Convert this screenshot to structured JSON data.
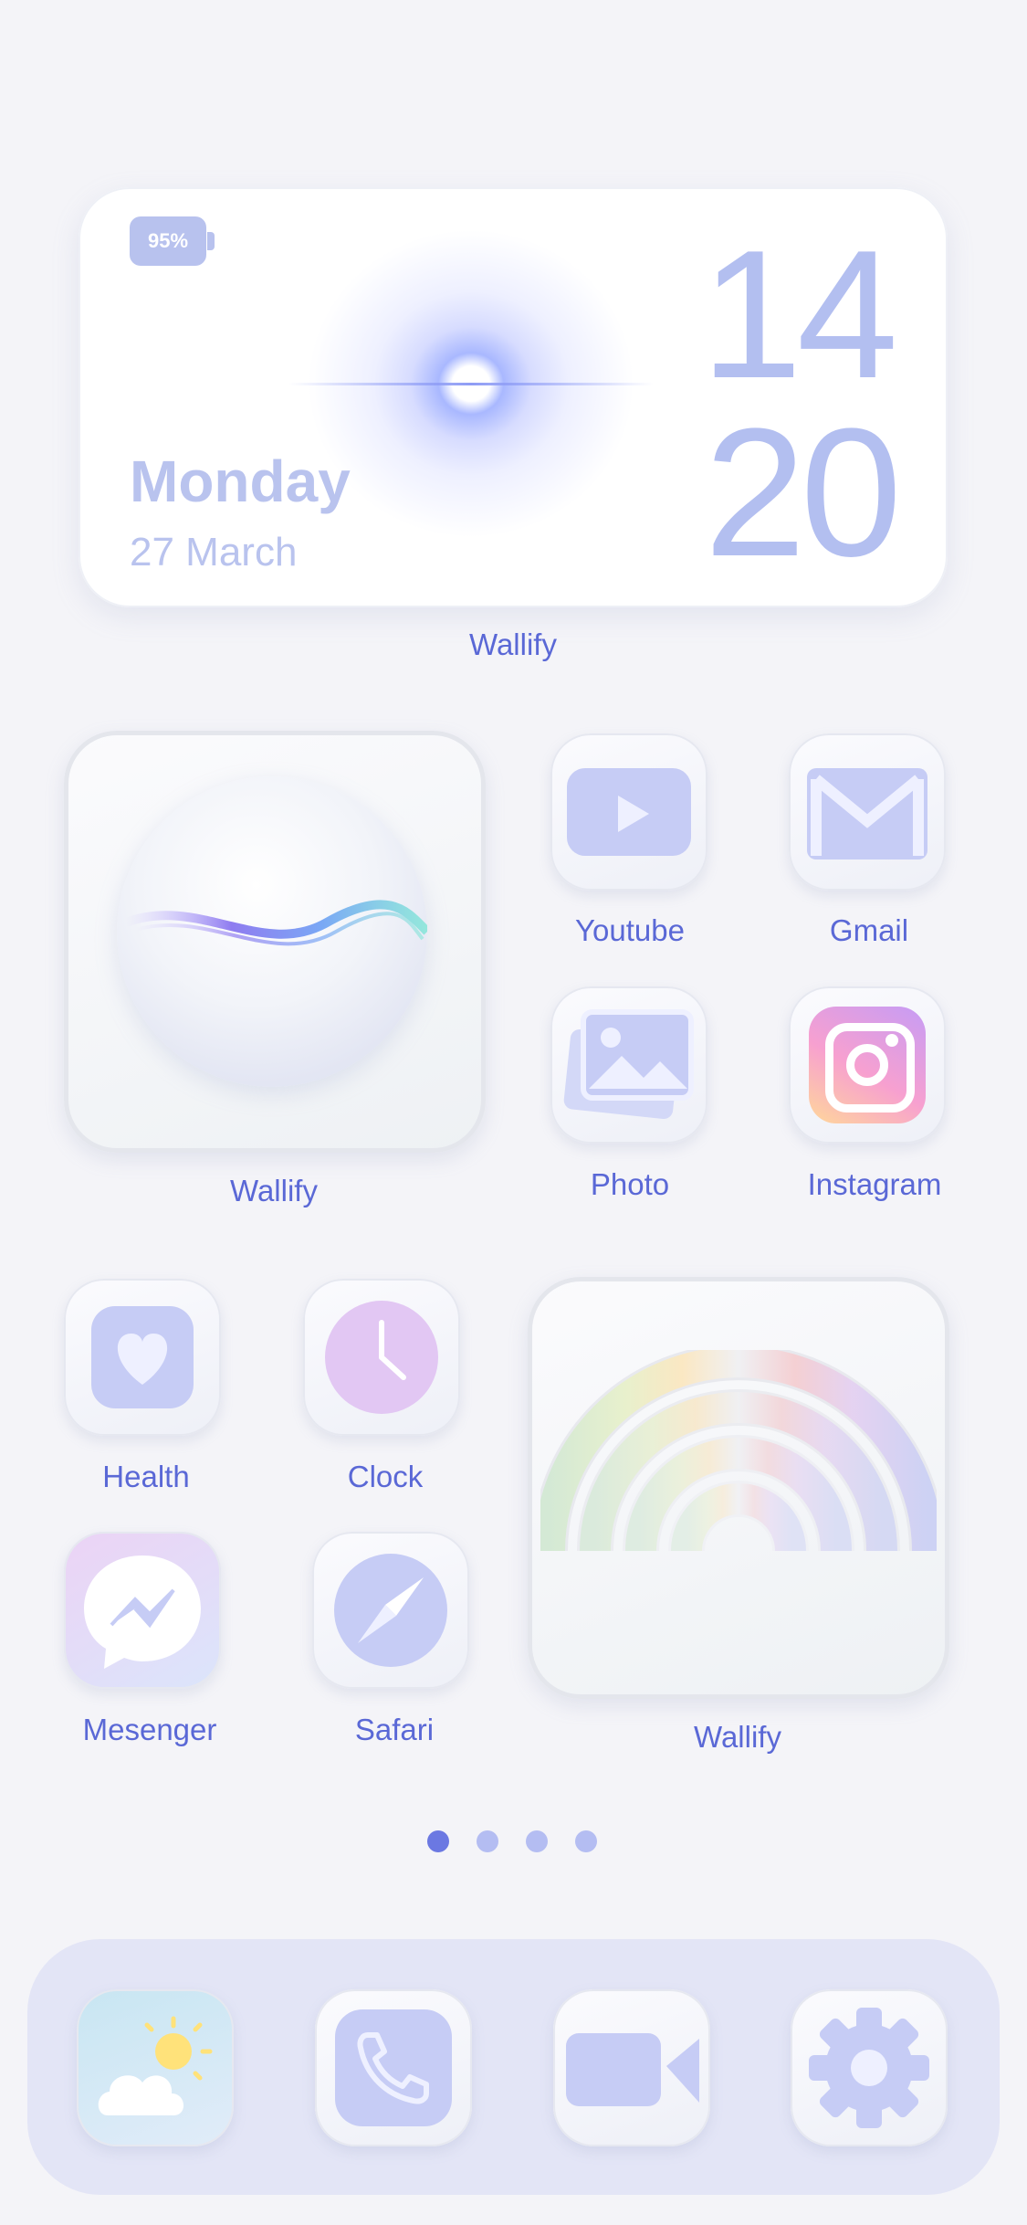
{
  "top_widget": {
    "battery": "95%",
    "day": "Monday",
    "date": "27 March",
    "hour": "14",
    "minute": "20",
    "label": "Wallify"
  },
  "grid": {
    "sphere_widget_label": "Wallify",
    "apps": {
      "youtube": "Youtube",
      "gmail": "Gmail",
      "photo": "Photo",
      "instagram": "Instagram",
      "health": "Health",
      "clock": "Clock",
      "messenger": "Mesenger",
      "safari": "Safari"
    },
    "rainbow_widget_label": "Wallify"
  },
  "page_indicator": {
    "count": 4,
    "active": 1
  },
  "dock": {
    "apps": [
      "weather-icon",
      "phone-icon",
      "facetime-icon",
      "settings-icon"
    ]
  },
  "colors": {
    "background": "#f4f4f8",
    "label": "#5a68d6",
    "accent": "#b3bff0",
    "dock": "#e3e5f6"
  }
}
